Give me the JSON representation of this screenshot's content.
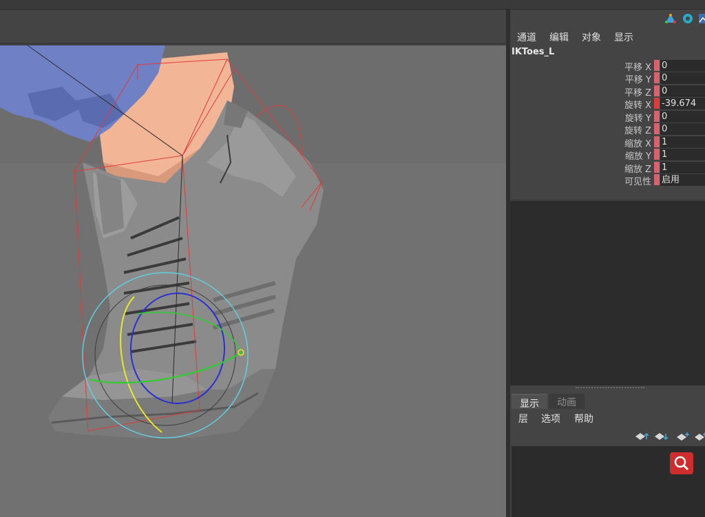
{
  "channel_box": {
    "menu": [
      "通道",
      "编辑",
      "对象",
      "显示"
    ],
    "node_name": "IKToes_L",
    "attributes": [
      {
        "label": "平移 X",
        "value": "0"
      },
      {
        "label": "平移 Y",
        "value": "0"
      },
      {
        "label": "平移 Z",
        "value": "0"
      },
      {
        "label": "旋转 X",
        "value": "-39.674"
      },
      {
        "label": "旋转 Y",
        "value": "0"
      },
      {
        "label": "旋转 Z",
        "value": "0"
      },
      {
        "label": "缩放 X",
        "value": "1"
      },
      {
        "label": "缩放 Y",
        "value": "1"
      },
      {
        "label": "缩放 Z",
        "value": "1"
      },
      {
        "label": "可见性",
        "value": "启用"
      }
    ],
    "icons": [
      "shape-tool-icon",
      "render-view-icon",
      "graph-icon"
    ]
  },
  "layer_editor": {
    "tabs": [
      "显示",
      "动画"
    ],
    "menu": [
      "层",
      "选项",
      "帮助"
    ],
    "tools": [
      "move-layer-up-icon",
      "move-layer-down-icon",
      "new-layer-icon",
      "new-layer-selected-icon"
    ],
    "search_icon": "search-icon"
  },
  "viewport": {
    "content": "3d-sneaker-foot-rig-viewport",
    "colors": {
      "background": "#707070",
      "skin": "#f0b393",
      "shoe": "#8a8a8a",
      "hair": "#6f80c4",
      "bbox": "#e23a3a"
    }
  }
}
